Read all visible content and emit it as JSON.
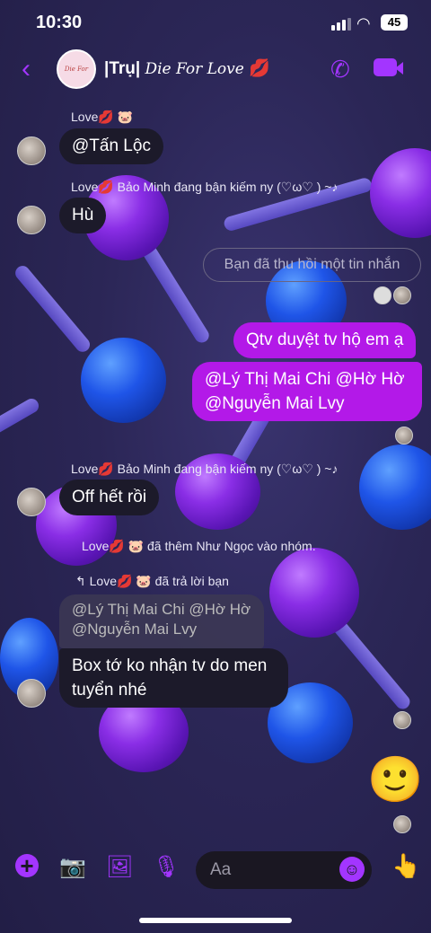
{
  "status": {
    "time": "10:30",
    "battery": "45"
  },
  "header": {
    "back": "‹",
    "title": "|Trụ|",
    "title_italic": "Die For Love",
    "title_emoji": "💋",
    "avatar_text": "Die For Love",
    "call_icon": "✆",
    "video_icon": "▶"
  },
  "messages": {
    "m1_label": "Love💋 🐷",
    "m1_text": "@Tấn Lộc",
    "m2_label": "Love💋 Bảo Minh đang bận kiếm ny (♡ω♡ ) ~♪",
    "m2_text": "Hù",
    "recall_text": "Bạn đã thu hồi một tin nhắn",
    "out1_text": "Qtv duyệt tv hộ em ạ",
    "out2_line1": "@Lý Thị Mai Chi @Hờ Hờ",
    "out2_line2": "@Nguyễn Mai Lvy",
    "m3_label": "Love💋 Bảo Minh đang bận kiếm ny (♡ω♡ ) ~♪",
    "m3_text": "Off hết rồi",
    "system_text": "Love💋 🐷 đã thêm Như Ngọc vào nhóm.",
    "reply_label": "↰ Love💋 🐷 đã trả lời bạn",
    "reply_quote_line1": "@Lý Thị Mai Chi @Hờ Hờ",
    "reply_quote_line2": "@Nguyễn Mai Lvy",
    "reply_text_line1": "Box tớ ko nhận tv do men",
    "reply_text_line2": "tuyển nhé",
    "big_emoji": "🙂"
  },
  "composer": {
    "placeholder": "Aa",
    "plus_icon": "+",
    "camera_icon": "📷",
    "image_icon": "🖼",
    "mic_icon": "🎙",
    "emoji_icon": "☺",
    "like_icon": "👆"
  },
  "colors": {
    "accent": "#a335ff",
    "outgoing_bubble": "#b319e8",
    "incoming_bubble": "#1c1a2a"
  }
}
